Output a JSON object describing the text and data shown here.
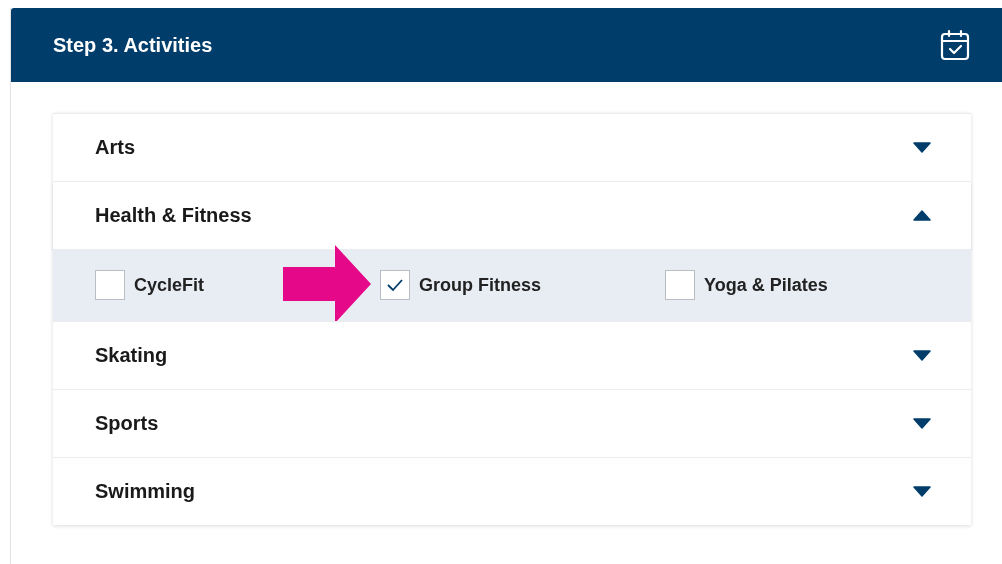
{
  "panel": {
    "title": "Step 3. Activities"
  },
  "categories": [
    {
      "label": "Arts",
      "expanded": false
    },
    {
      "label": "Health & Fitness",
      "expanded": true,
      "options": [
        {
          "label": "CycleFit",
          "checked": false
        },
        {
          "label": "Group Fitness",
          "checked": true
        },
        {
          "label": "Yoga & Pilates",
          "checked": false
        }
      ]
    },
    {
      "label": "Skating",
      "expanded": false
    },
    {
      "label": "Sports",
      "expanded": false
    },
    {
      "label": "Swimming",
      "expanded": false
    }
  ]
}
